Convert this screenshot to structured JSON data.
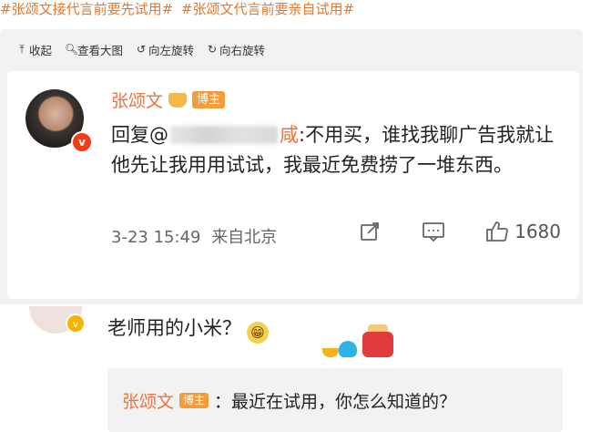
{
  "header": {
    "tags": [
      "#张颂文接代言前要先试用#",
      "#张颂文代言前要亲自试用#"
    ]
  },
  "toolbar": {
    "collapse": "收起",
    "view_large": "查看大图",
    "rotate_left": "向左旋转",
    "rotate_right": "向右旋转"
  },
  "post": {
    "author": "张颂文",
    "badge": "博主",
    "reply_prefix": "回复@",
    "mention_tail": "咸",
    "text": ":不用买，谁找我聊广告我就让他先让我用用试试，我最近免费捞了一堆东西。",
    "timestamp": "3-23 15:49",
    "location": "来自北京",
    "like_count": "1680"
  },
  "comment": {
    "text": "老师用的小米？",
    "emoji": "😁"
  },
  "subreply": {
    "author": "张颂文",
    "badge": "博主",
    "text": "：最近在试用，你怎么知道的？"
  },
  "colors": {
    "accent": "#eb7340",
    "tag": "#e4772a",
    "badge": "#f39c3c"
  }
}
